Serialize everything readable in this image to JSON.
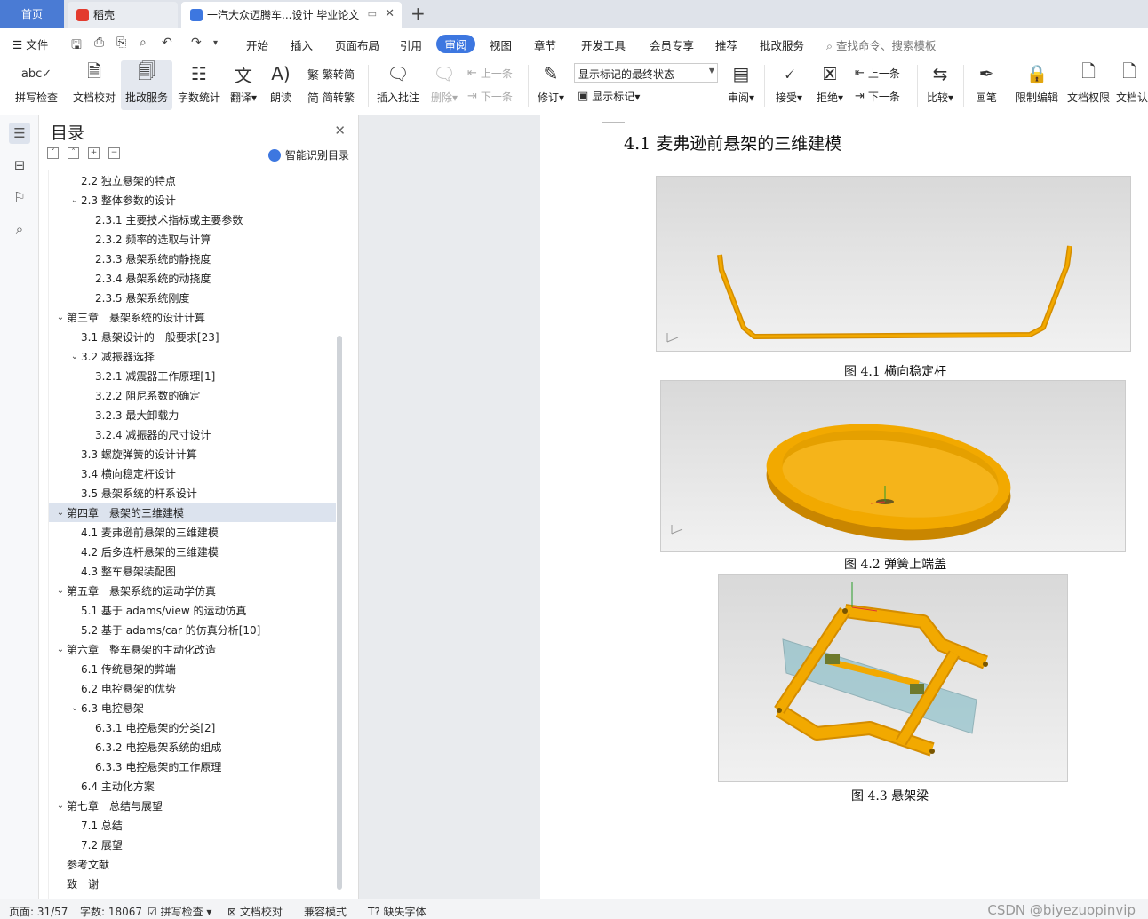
{
  "tabs": {
    "home": "首页",
    "daoke": "稻壳",
    "document": "一汽大众迈腾车...设计 毕业论文"
  },
  "menu": {
    "file": "文件",
    "items": [
      "开始",
      "插入",
      "页面布局",
      "引用",
      "审阅",
      "视图",
      "章节",
      "开发工具",
      "会员专享",
      "推荐",
      "批改服务"
    ],
    "active": "审阅",
    "search_placeholder": "查找命令、搜索模板"
  },
  "ribbon": {
    "spell_check": "拼写检查",
    "doc_proof": "文档校对",
    "correct_service": "批改服务",
    "word_count": "字数统计",
    "translate": "翻译",
    "read_aloud": "朗读",
    "trad_convert": "繁转简",
    "simp_convert": "简转繁",
    "insert_comment": "插入批注",
    "delete": "删除",
    "prev": "上一条",
    "next": "下一条",
    "revise": "修订",
    "markup_state": "显示标记的最终状态",
    "show_markup": "显示标记",
    "review": "审阅",
    "accept": "接受",
    "reject": "拒绝",
    "prev2": "上一条",
    "next2": "下一条",
    "compare": "比较",
    "pen": "画笔",
    "restrict_edit": "限制编辑",
    "doc_permission": "文档权限",
    "doc_cert": "文档认"
  },
  "toc": {
    "title": "目录",
    "smart": "智能识别目录",
    "items": [
      {
        "text": "2.2 独立悬架的特点",
        "level": 2,
        "chev": ""
      },
      {
        "text": "2.3 整体参数的设计",
        "level": 2,
        "chev": "v"
      },
      {
        "text": "2.3.1 主要技术指标或主要参数",
        "level": 3,
        "chev": ""
      },
      {
        "text": "2.3.2 频率的选取与计算",
        "level": 3,
        "chev": ""
      },
      {
        "text": "2.3.3 悬架系统的静挠度",
        "level": 3,
        "chev": ""
      },
      {
        "text": "2.3.4 悬架系统的动挠度",
        "level": 3,
        "chev": ""
      },
      {
        "text": "2.3.5 悬架系统刚度",
        "level": 3,
        "chev": ""
      },
      {
        "text": "第三章　悬架系统的设计计算",
        "level": 1,
        "chev": "v"
      },
      {
        "text": "3.1 悬架设计的一般要求[23]",
        "level": 2,
        "chev": ""
      },
      {
        "text": "3.2 减振器选择",
        "level": 2,
        "chev": "v"
      },
      {
        "text": "3.2.1 减震器工作原理[1]",
        "level": 3,
        "chev": ""
      },
      {
        "text": "3.2.2 阻尼系数的确定",
        "level": 3,
        "chev": ""
      },
      {
        "text": "3.2.3 最大卸载力",
        "level": 3,
        "chev": ""
      },
      {
        "text": "3.2.4 减振器的尺寸设计",
        "level": 3,
        "chev": ""
      },
      {
        "text": "3.3 螺旋弹簧的设计计算",
        "level": 2,
        "chev": ""
      },
      {
        "text": "3.4 横向稳定杆设计",
        "level": 2,
        "chev": ""
      },
      {
        "text": "3.5 悬架系统的杆系设计",
        "level": 2,
        "chev": ""
      },
      {
        "text": "第四章　悬架的三维建模",
        "level": 1,
        "chev": "v",
        "selected": true
      },
      {
        "text": "4.1 麦弗逊前悬架的三维建模",
        "level": 2,
        "chev": ""
      },
      {
        "text": "4.2 后多连杆悬架的三维建模",
        "level": 2,
        "chev": ""
      },
      {
        "text": "4.3 整车悬架装配图",
        "level": 2,
        "chev": ""
      },
      {
        "text": "第五章　悬架系统的运动学仿真",
        "level": 1,
        "chev": "v"
      },
      {
        "text": "5.1 基于 adams/view 的运动仿真",
        "level": 2,
        "chev": ""
      },
      {
        "text": "5.2 基于 adams/car 的仿真分析[10]",
        "level": 2,
        "chev": ""
      },
      {
        "text": "第六章　整车悬架的主动化改造",
        "level": 1,
        "chev": "v"
      },
      {
        "text": "6.1 传统悬架的弊端",
        "level": 2,
        "chev": ""
      },
      {
        "text": "6.2 电控悬架的优势",
        "level": 2,
        "chev": ""
      },
      {
        "text": "6.3 电控悬架",
        "level": 2,
        "chev": "v"
      },
      {
        "text": "6.3.1 电控悬架的分类[2]",
        "level": 3,
        "chev": ""
      },
      {
        "text": "6.3.2 电控悬架系统的组成",
        "level": 3,
        "chev": ""
      },
      {
        "text": "6.3.3 电控悬架的工作原理",
        "level": 3,
        "chev": ""
      },
      {
        "text": "6.4 主动化方案",
        "level": 2,
        "chev": ""
      },
      {
        "text": "第七章　总结与展望",
        "level": 1,
        "chev": "v"
      },
      {
        "text": "7.1 总结",
        "level": 2,
        "chev": ""
      },
      {
        "text": "7.2 展望",
        "level": 2,
        "chev": ""
      },
      {
        "text": "参考文献",
        "level": 1,
        "chev": ""
      },
      {
        "text": "致　谢",
        "level": 1,
        "chev": ""
      }
    ]
  },
  "document": {
    "heading": "4.1 麦弗逊前悬架的三维建模",
    "captions": [
      "图 4.1 横向稳定杆",
      "图 4.2 弹簧上端盖",
      "图 4.3 悬架梁"
    ]
  },
  "status": {
    "page": "页面: 31/57",
    "words": "字数: 18067",
    "spell": "拼写检查",
    "proof": "文档校对",
    "compat": "兼容模式",
    "missing_font": "缺失字体",
    "watermark": "CSDN @biyezuopinvip"
  },
  "colors": {
    "accent": "#3d77e0",
    "model_orange": "#f2a900",
    "plane_teal": "#7fb9c4"
  }
}
